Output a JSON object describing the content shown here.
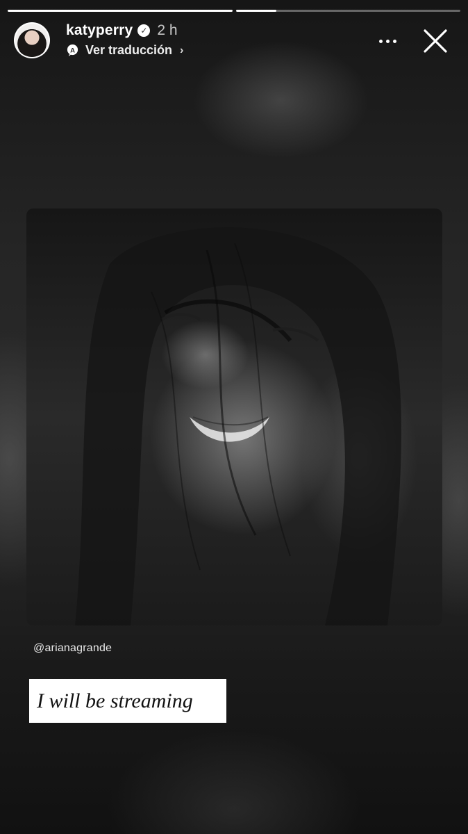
{
  "story": {
    "progress": [
      1.0,
      0.18
    ],
    "user": {
      "username": "katyperry",
      "time": "2 h",
      "translate_label": "Ver traducción",
      "avatar_icon": "avatar-photo",
      "verified_icon": "verified-badge-icon"
    },
    "actions": {
      "more_icon": "more-options-icon",
      "close_icon": "close-icon"
    },
    "post": {
      "image": "black-and-white-photo-smiling-woman",
      "mention": "@arianagrande",
      "caption": "I will be streaming"
    }
  }
}
